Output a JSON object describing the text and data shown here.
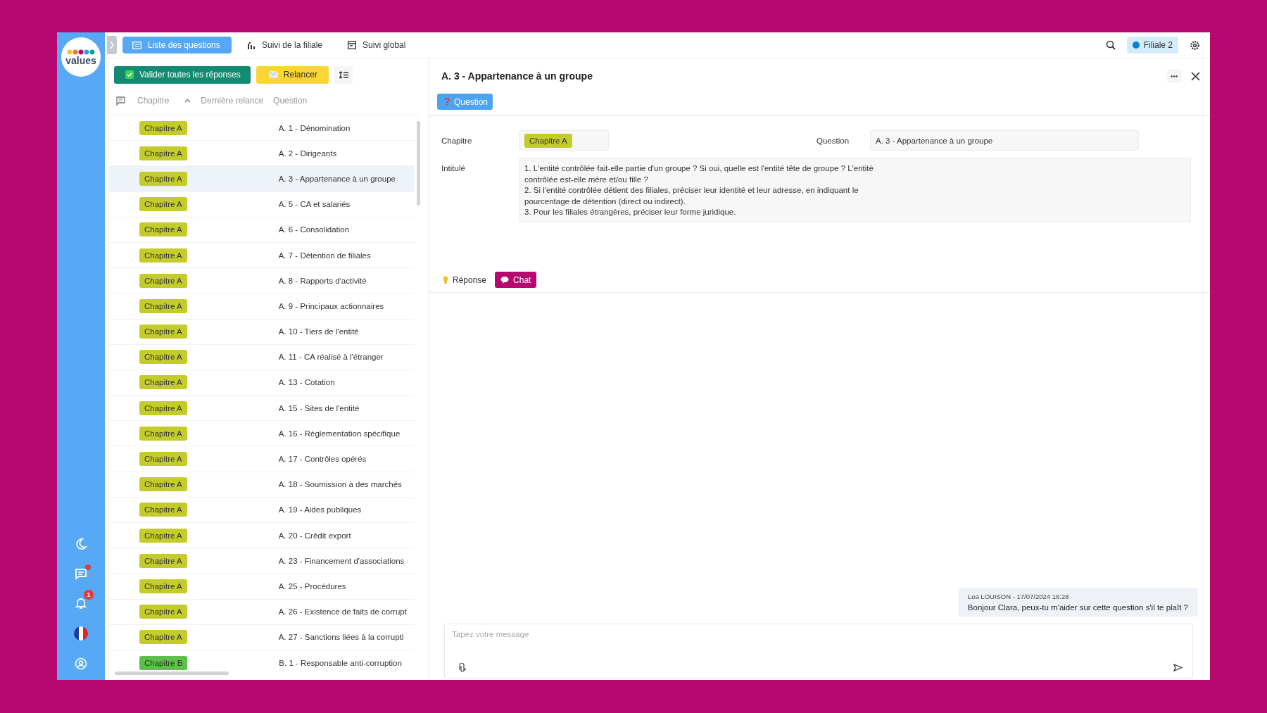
{
  "sidebar": {
    "logo": "values",
    "icons": [
      {
        "kind": "moon",
        "dot": false
      },
      {
        "kind": "chat",
        "dot": true
      },
      {
        "kind": "bell",
        "dot": false,
        "badge": "1"
      },
      {
        "kind": "flag",
        "dot": false
      },
      {
        "kind": "user",
        "dot": false
      }
    ]
  },
  "tabs": [
    {
      "label": "Liste des questions",
      "kind": "list",
      "selected": true
    },
    {
      "label": "Suivi de la filiale",
      "kind": "bars",
      "selected": false
    },
    {
      "label": "Suivi global",
      "kind": "calendar",
      "selected": false
    }
  ],
  "subsidiary": {
    "label": "Filiale 2",
    "color": "#0a7fd1"
  },
  "toolbar": {
    "validate": "Valider toutes les réponses",
    "remind": "Relancer"
  },
  "table": {
    "columns": [
      "Chapitre",
      "Dernière relance",
      "Question"
    ],
    "rows": [
      {
        "chapter": "Chapitre A",
        "color": "#c4cc2c",
        "question": "A. 1 - Dénomination",
        "selected": false
      },
      {
        "chapter": "Chapitre A",
        "color": "#c4cc2c",
        "question": "A. 2 - Dirigeants",
        "selected": false
      },
      {
        "chapter": "Chapitre A",
        "color": "#c4cc2c",
        "question": "A. 3 - Appartenance à un groupe",
        "selected": true
      },
      {
        "chapter": "Chapitre A",
        "color": "#c4cc2c",
        "question": "A. 5 - CA et salariés",
        "selected": false
      },
      {
        "chapter": "Chapitre A",
        "color": "#c4cc2c",
        "question": "A. 6 - Consolidation",
        "selected": false
      },
      {
        "chapter": "Chapitre A",
        "color": "#c4cc2c",
        "question": "A. 7 - Détention de filiales",
        "selected": false
      },
      {
        "chapter": "Chapitre A",
        "color": "#c4cc2c",
        "question": "A. 8 - Rapports d'activité",
        "selected": false
      },
      {
        "chapter": "Chapitre A",
        "color": "#c4cc2c",
        "question": "A. 9 - Principaux actionnaires",
        "selected": false
      },
      {
        "chapter": "Chapitre A",
        "color": "#c4cc2c",
        "question": "A. 10 - Tiers de l'entité",
        "selected": false
      },
      {
        "chapter": "Chapitre A",
        "color": "#c4cc2c",
        "question": "A. 11 - CA réalisé à l'étranger",
        "selected": false
      },
      {
        "chapter": "Chapitre A",
        "color": "#c4cc2c",
        "question": "A. 13 - Cotation",
        "selected": false
      },
      {
        "chapter": "Chapitre A",
        "color": "#c4cc2c",
        "question": "A. 15 - Sites de l'entité",
        "selected": false
      },
      {
        "chapter": "Chapitre A",
        "color": "#c4cc2c",
        "question": "A. 16 - Règlementation spécifique",
        "selected": false
      },
      {
        "chapter": "Chapitre A",
        "color": "#c4cc2c",
        "question": "A. 17 - Contrôles opérés",
        "selected": false
      },
      {
        "chapter": "Chapitre A",
        "color": "#c4cc2c",
        "question": "A. 18 - Soumission à des marchés",
        "selected": false
      },
      {
        "chapter": "Chapitre A",
        "color": "#c4cc2c",
        "question": "A. 19 - Aides publiques",
        "selected": false
      },
      {
        "chapter": "Chapitre A",
        "color": "#c4cc2c",
        "question": "A. 20 - Crédit export",
        "selected": false
      },
      {
        "chapter": "Chapitre A",
        "color": "#c4cc2c",
        "question": "A. 23 - Financement d'associations",
        "selected": false
      },
      {
        "chapter": "Chapitre A",
        "color": "#c4cc2c",
        "question": "A. 25 - Procédures",
        "selected": false
      },
      {
        "chapter": "Chapitre A",
        "color": "#c4cc2c",
        "question": "A. 26 - Existence de faits de corrupt",
        "selected": false
      },
      {
        "chapter": "Chapitre A",
        "color": "#c4cc2c",
        "question": "A. 27 - Sanctions liées à la corrupti",
        "selected": false
      },
      {
        "chapter": "Chapitre B",
        "color": "#5cbf4a",
        "question": "B. 1 - Responsable anti-corruption",
        "selected": false
      }
    ]
  },
  "detail": {
    "title": "A. 3 - Appartenance à un groupe",
    "section": "Question",
    "chapter_label": "Chapitre",
    "chapter": "Chapitre A",
    "question_label": "Question",
    "question": "A. 3 - Appartenance à un groupe",
    "wording_label": "Intitulé",
    "wording": [
      "1. L'entité contrôlée fait-elle partie d'un groupe ? Si oui, quelle est l'entité tête de groupe ? L'entité",
      "contrôlée est-elle mère et/ou fille ?",
      "2. Si l'entité contrôlée détient des filiales, préciser leur identité et leur adresse, en indiquant le",
      "pourcentage de détention (direct ou indirect).",
      "3. Pour les filiales étrangères, préciser leur forme juridique."
    ],
    "tabs": [
      {
        "label": "Réponse",
        "kind": "bulb",
        "selected": false
      },
      {
        "label": "Chat",
        "kind": "bubble",
        "selected": true
      }
    ],
    "messages": [
      {
        "meta": "Lea LOUISON - 17/07/2024 16:28",
        "text": "Bonjour Clara, peux-tu m'aider sur cette question s'il te plaît ?"
      }
    ],
    "composer": {
      "placeholder": "Tapez votre message"
    }
  }
}
